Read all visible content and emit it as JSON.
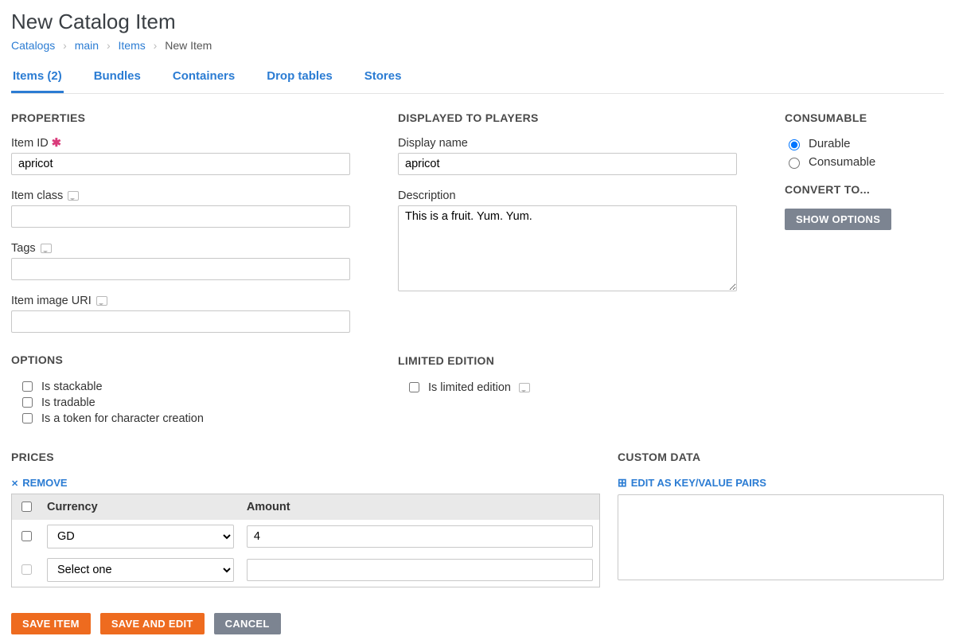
{
  "page_title": "New Catalog Item",
  "breadcrumb": [
    {
      "label": "Catalogs",
      "link": true
    },
    {
      "label": "main",
      "link": true
    },
    {
      "label": "Items",
      "link": true
    },
    {
      "label": "New Item",
      "link": false
    }
  ],
  "tabs": [
    {
      "label": "Items (2)",
      "active": true
    },
    {
      "label": "Bundles",
      "active": false
    },
    {
      "label": "Containers",
      "active": false
    },
    {
      "label": "Drop tables",
      "active": false
    },
    {
      "label": "Stores",
      "active": false
    }
  ],
  "properties": {
    "heading": "PROPERTIES",
    "item_id_label": "Item ID",
    "item_id_value": "apricot",
    "item_class_label": "Item class",
    "item_class_value": "",
    "tags_label": "Tags",
    "tags_value": "",
    "image_uri_label": "Item image URI",
    "image_uri_value": ""
  },
  "displayed": {
    "heading": "DISPLAYED TO PLAYERS",
    "display_name_label": "Display name",
    "display_name_value": "apricot",
    "description_label": "Description",
    "description_value": "This is a fruit. Yum. Yum."
  },
  "consumable": {
    "heading": "CONSUMABLE",
    "durable_label": "Durable",
    "consumable_label": "Consumable",
    "selected": "Durable"
  },
  "convert": {
    "heading": "CONVERT TO...",
    "button": "SHOW OPTIONS"
  },
  "options": {
    "heading": "OPTIONS",
    "stackable": "Is stackable",
    "tradable": "Is tradable",
    "token": "Is a token for character creation"
  },
  "limited": {
    "heading": "LIMITED EDITION",
    "label": "Is limited edition"
  },
  "prices": {
    "heading": "PRICES",
    "remove_label": "REMOVE",
    "col_currency": "Currency",
    "col_amount": "Amount",
    "rows": [
      {
        "currency": "GD",
        "amount": "4"
      },
      {
        "currency": "Select one",
        "amount": ""
      }
    ]
  },
  "custom": {
    "heading": "CUSTOM DATA",
    "edit_label": "EDIT AS KEY/VALUE PAIRS"
  },
  "actions": {
    "save": "SAVE ITEM",
    "save_edit": "SAVE AND EDIT",
    "cancel": "CANCEL"
  }
}
